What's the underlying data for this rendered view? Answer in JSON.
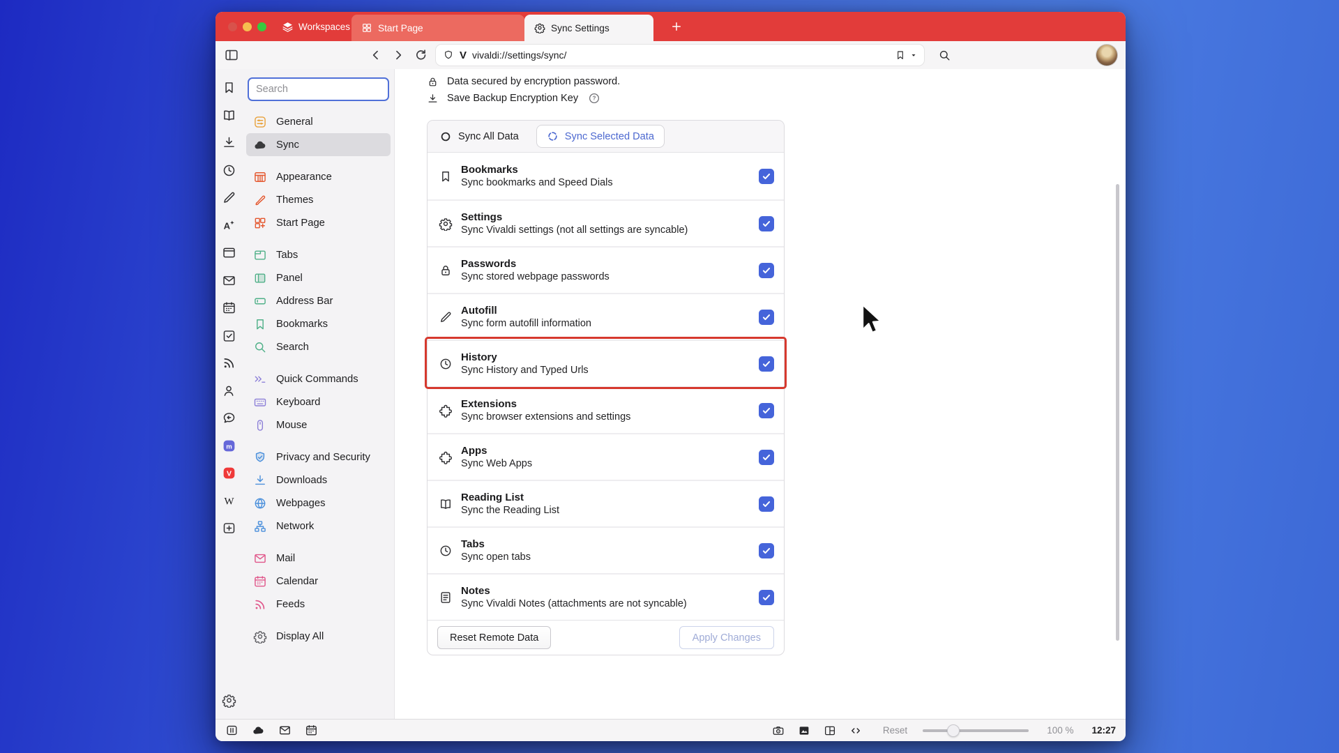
{
  "tab_bar": {
    "workspaces_label": "Workspaces",
    "tabs": [
      {
        "label": "Start Page",
        "icon": "speed-dial",
        "active": false
      },
      {
        "label": "Sync Settings",
        "icon": "gear",
        "active": true
      }
    ]
  },
  "toolbar": {
    "url": "vivaldi://settings/sync/"
  },
  "panel_strip": {
    "icons": [
      "bookmark",
      "reading-list",
      "download",
      "history",
      "notes",
      "translate",
      "window",
      "mail",
      "calendar",
      "tasks",
      "feeds",
      "contacts",
      "session",
      "mastodon",
      "vivaldi",
      "wikipedia",
      "add-webpanel"
    ],
    "bottom_icon": "settings"
  },
  "settings_nav": {
    "search_placeholder": "Search",
    "groups": [
      {
        "color": "#e8a23c",
        "items": [
          {
            "label": "General",
            "icon": "general"
          },
          {
            "label": "Sync",
            "icon": "cloud",
            "selected": true,
            "color": "#3a3a3c"
          }
        ]
      },
      {
        "color": "#e4572e",
        "items": [
          {
            "label": "Appearance",
            "icon": "appearance"
          },
          {
            "label": "Themes",
            "icon": "brush"
          },
          {
            "label": "Start Page",
            "icon": "start-page"
          }
        ]
      },
      {
        "color": "#4fb088",
        "items": [
          {
            "label": "Tabs",
            "icon": "tab"
          },
          {
            "label": "Panel",
            "icon": "panel"
          },
          {
            "label": "Address Bar",
            "icon": "address-bar"
          },
          {
            "label": "Bookmarks",
            "icon": "bookmark"
          },
          {
            "label": "Search",
            "icon": "search"
          }
        ]
      },
      {
        "color": "#8d80d8",
        "items": [
          {
            "label": "Quick Commands",
            "icon": "quick-commands"
          },
          {
            "label": "Keyboard",
            "icon": "keyboard"
          },
          {
            "label": "Mouse",
            "icon": "mouse"
          }
        ]
      },
      {
        "color": "#4a8fdb",
        "items": [
          {
            "label": "Privacy and Security",
            "icon": "shield-check"
          },
          {
            "label": "Downloads",
            "icon": "download"
          },
          {
            "label": "Webpages",
            "icon": "globe"
          },
          {
            "label": "Network",
            "icon": "network"
          }
        ]
      },
      {
        "color": "#e0568a",
        "items": [
          {
            "label": "Mail",
            "icon": "mail"
          },
          {
            "label": "Calendar",
            "icon": "calendar"
          },
          {
            "label": "Feeds",
            "icon": "feeds"
          }
        ]
      },
      {
        "color": "#5f5f64",
        "items": [
          {
            "label": "Display All",
            "icon": "gear"
          }
        ]
      }
    ]
  },
  "sync_page": {
    "secured_line": "Data secured by encryption password.",
    "backup_line": "Save Backup Encryption Key",
    "mode": {
      "all_label": "Sync All Data",
      "selected_label": "Sync Selected Data"
    },
    "items": [
      {
        "title": "Bookmarks",
        "desc": "Sync bookmarks and Speed Dials",
        "icon": "bookmark",
        "checked": true,
        "highlighted": false
      },
      {
        "title": "Settings",
        "desc": "Sync Vivaldi settings (not all settings are syncable)",
        "icon": "gear",
        "checked": true,
        "highlighted": false
      },
      {
        "title": "Passwords",
        "desc": "Sync stored webpage passwords",
        "icon": "lock",
        "checked": true,
        "highlighted": false
      },
      {
        "title": "Autofill",
        "desc": "Sync form autofill information",
        "icon": "pen",
        "checked": true,
        "highlighted": false
      },
      {
        "title": "History",
        "desc": "Sync History and Typed Urls",
        "icon": "clock",
        "checked": true,
        "highlighted": true
      },
      {
        "title": "Extensions",
        "desc": "Sync browser extensions and settings",
        "icon": "puzzle",
        "checked": true,
        "highlighted": false
      },
      {
        "title": "Apps",
        "desc": "Sync Web Apps",
        "icon": "puzzle",
        "checked": true,
        "highlighted": false
      },
      {
        "title": "Reading List",
        "desc": "Sync the Reading List",
        "icon": "reading-list",
        "checked": true,
        "highlighted": false
      },
      {
        "title": "Tabs",
        "desc": "Sync open tabs",
        "icon": "clock",
        "checked": true,
        "highlighted": false
      },
      {
        "title": "Notes",
        "desc": "Sync Vivaldi Notes (attachments are not syncable)",
        "icon": "notes-doc",
        "checked": true,
        "highlighted": false
      }
    ],
    "reset_button": "Reset Remote Data",
    "apply_button": "Apply Changes"
  },
  "status_bar": {
    "left_icons": [
      "pause-panel",
      "cloud",
      "mail",
      "calendar"
    ],
    "right_icons": [
      "camera",
      "image",
      "tile",
      "code"
    ],
    "reset_label": "Reset",
    "zoom_value": "100 %",
    "time": "12:27"
  },
  "colors": {
    "accent_blue": "#4564da",
    "link_blue": "#4c68d0",
    "highlight_red": "#d6392e",
    "tabbar_red": "#e23c3a",
    "inactive_tab_red": "#ec6a60",
    "sidebar_bg": "#f4f3f5",
    "selected_item_bg": "#dcdbdf"
  }
}
